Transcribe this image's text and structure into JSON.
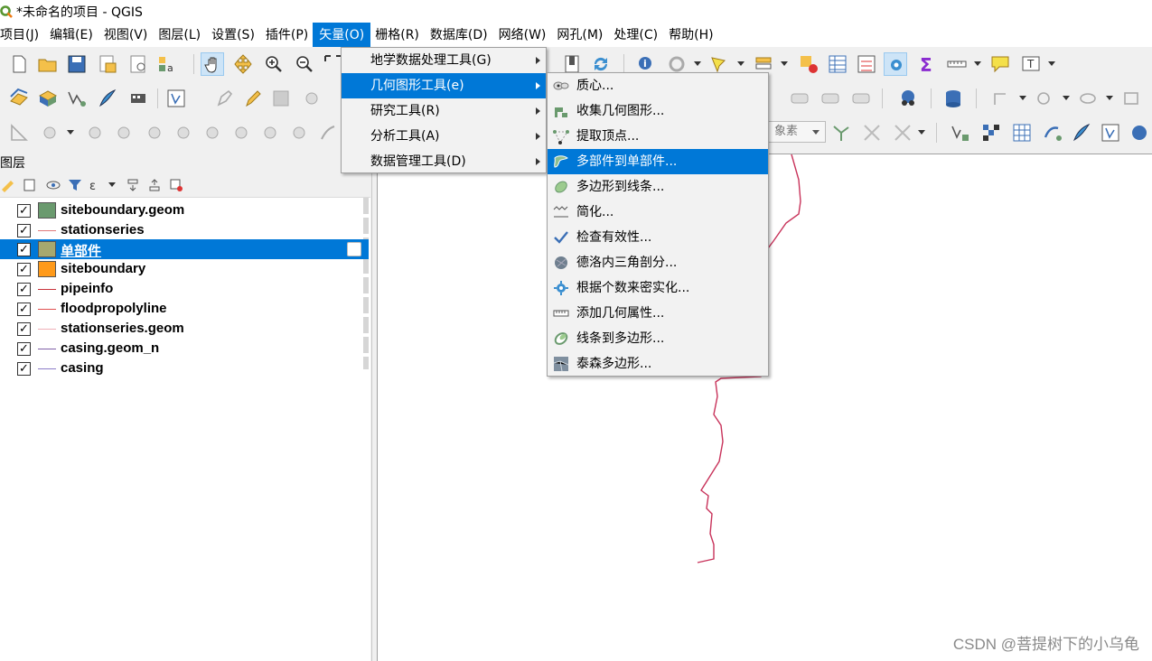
{
  "window": {
    "title": "*未命名的项目 - QGIS"
  },
  "menubar": {
    "items": [
      {
        "label": "项目(J)"
      },
      {
        "label": "编辑(E)"
      },
      {
        "label": "视图(V)"
      },
      {
        "label": "图层(L)"
      },
      {
        "label": "设置(S)"
      },
      {
        "label": "插件(P)"
      },
      {
        "label": "矢量(O)"
      },
      {
        "label": "栅格(R)"
      },
      {
        "label": "数据库(D)"
      },
      {
        "label": "网络(W)"
      },
      {
        "label": "网孔(M)"
      },
      {
        "label": "处理(C)"
      },
      {
        "label": "帮助(H)"
      }
    ]
  },
  "vector_menu": {
    "items": [
      {
        "label": "地学数据处理工具(G)"
      },
      {
        "label": "几何图形工具(e)"
      },
      {
        "label": "研究工具(R)"
      },
      {
        "label": "分析工具(A)"
      },
      {
        "label": "数据管理工具(D)"
      }
    ]
  },
  "geometry_menu": {
    "items": [
      {
        "label": "质心...",
        "icon": "centroid-icon"
      },
      {
        "label": "收集几何图形...",
        "icon": "collect-geometries-icon"
      },
      {
        "label": "提取顶点...",
        "icon": "extract-vertices-icon"
      },
      {
        "label": "多部件到单部件...",
        "icon": "multipart-to-singlepart-icon"
      },
      {
        "label": "多边形到线条...",
        "icon": "polygon-to-line-icon"
      },
      {
        "label": "简化...",
        "icon": "simplify-icon"
      },
      {
        "label": "检查有效性...",
        "icon": "check-validity-icon"
      },
      {
        "label": "德洛内三角剖分...",
        "icon": "delaunay-icon"
      },
      {
        "label": "根据个数来密实化...",
        "icon": "densify-icon"
      },
      {
        "label": "添加几何属性...",
        "icon": "geometry-attributes-icon"
      },
      {
        "label": "线条到多边形...",
        "icon": "line-to-polygon-icon"
      },
      {
        "label": "泰森多边形...",
        "icon": "voronoi-icon"
      }
    ]
  },
  "snapping": {
    "combo_value": "象素"
  },
  "layers_panel": {
    "title": "图层",
    "layers": [
      {
        "name": "siteboundary.geom",
        "type": "polygon",
        "color": "#6a9a6e"
      },
      {
        "name": "stationseries",
        "type": "line",
        "color": "#e07a7a"
      },
      {
        "name": "单部件",
        "type": "polygon",
        "color": "#a6a86f"
      },
      {
        "name": "siteboundary",
        "type": "polygon",
        "color": "#ff9a1a"
      },
      {
        "name": "pipeinfo",
        "type": "line",
        "color": "#c8323a"
      },
      {
        "name": "floodpropolyline",
        "type": "line",
        "color": "#e05050"
      },
      {
        "name": "stationseries.geom",
        "type": "line",
        "color": "#f0b0b8"
      },
      {
        "name": "casing.geom_n",
        "type": "line",
        "color": "#8060a8"
      },
      {
        "name": "casing",
        "type": "line",
        "color": "#8c7cc8"
      }
    ]
  },
  "map": {
    "line_color": "#c8325a"
  },
  "watermark": {
    "text": "CSDN @菩提树下的小乌龟"
  },
  "colors": {
    "accent": "#0078d7"
  }
}
